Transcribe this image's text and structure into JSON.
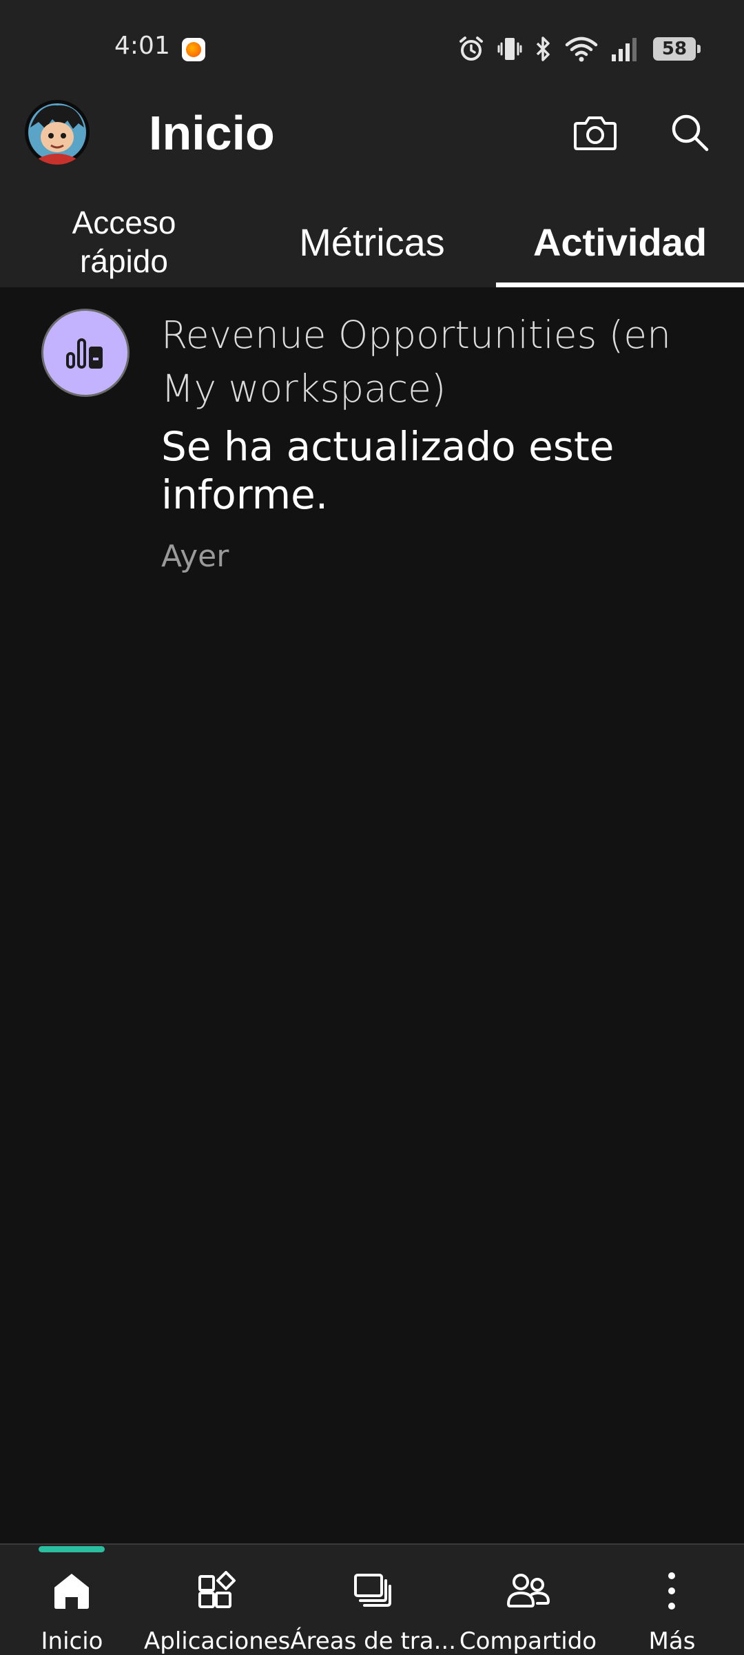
{
  "status_bar": {
    "time": "4:01",
    "battery": "58",
    "icons": [
      "notification-app-icon",
      "alarm-icon",
      "vibrate-icon",
      "bluetooth-icon",
      "wifi-icon",
      "signal-icon",
      "battery-icon"
    ]
  },
  "header": {
    "title": "Inicio",
    "avatar_icon": "user-avatar",
    "camera_icon": "camera-icon",
    "search_icon": "search-icon"
  },
  "tabs": [
    {
      "label": "Acceso\nrápido",
      "active": false
    },
    {
      "label": "Métricas",
      "active": false
    },
    {
      "label": "Actividad",
      "active": true
    }
  ],
  "activity": [
    {
      "icon": "report-chart-icon",
      "icon_color": "#c3b3ff",
      "title": "Revenue Opportunities (en My workspace)",
      "description": "Se ha actualizado este informe.",
      "time": "Ayer"
    }
  ],
  "bottom_nav": [
    {
      "label": "Inicio",
      "icon": "home-icon",
      "active": true
    },
    {
      "label": "Aplicaciones",
      "icon": "apps-icon",
      "active": false
    },
    {
      "label": "Áreas de tra...",
      "icon": "workspaces-icon",
      "active": false
    },
    {
      "label": "Compartido",
      "icon": "shared-icon",
      "active": false
    },
    {
      "label": "Más",
      "icon": "more-icon",
      "active": false
    }
  ],
  "colors": {
    "background": "#121212",
    "bar": "#222222",
    "accent": "#2bbd9f",
    "report_icon_bg": "#c3b3ff"
  }
}
